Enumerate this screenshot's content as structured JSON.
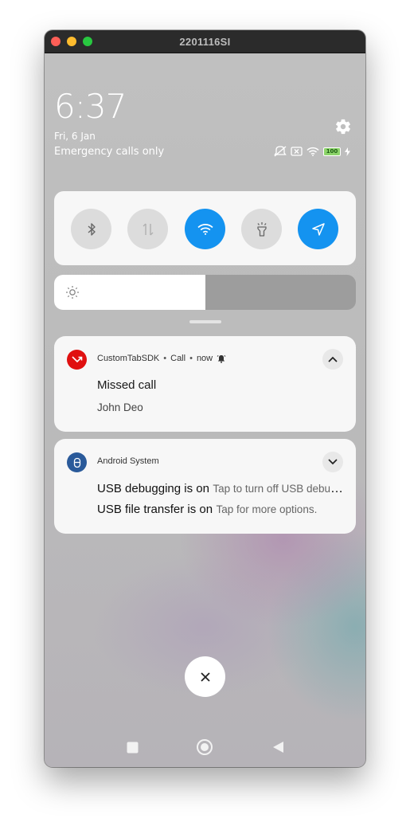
{
  "window": {
    "title": "2201116SI"
  },
  "status": {
    "time": "6:37",
    "date": "Fri, 6 Jan",
    "network": "Emergency calls only",
    "battery_level": "100",
    "icons": [
      "muted-vibrate-icon",
      "no-sim-icon",
      "wifi-icon",
      "battery-icon",
      "charging-icon"
    ]
  },
  "quick_settings": {
    "toggles": [
      {
        "name": "bluetooth",
        "icon": "bluetooth-icon",
        "state": "off"
      },
      {
        "name": "mobile-data",
        "icon": "mobile-data-icon",
        "state": "off"
      },
      {
        "name": "wifi",
        "icon": "wifi-icon",
        "state": "on"
      },
      {
        "name": "flashlight",
        "icon": "flashlight-icon",
        "state": "off"
      },
      {
        "name": "location",
        "icon": "location-icon",
        "state": "on"
      }
    ],
    "brightness_level": 0.5
  },
  "notifications": [
    {
      "app_name": "CustomTabSDK",
      "category": "Call",
      "time": "now",
      "title": "Missed call",
      "text": "John Deo",
      "app_icon_color": "#e01010"
    },
    {
      "app_name": "Android System",
      "lines": [
        {
          "title": "USB debugging is on",
          "text": "Tap to turn off USB debugging."
        },
        {
          "title": "USB file transfer is on",
          "text": "Tap for more options."
        }
      ],
      "app_icon_color": "#2a5a9a"
    }
  ],
  "colors": {
    "accent": "#1493f0",
    "panel": "#f7f7f7",
    "toggle_off": "#dcdcdc"
  }
}
